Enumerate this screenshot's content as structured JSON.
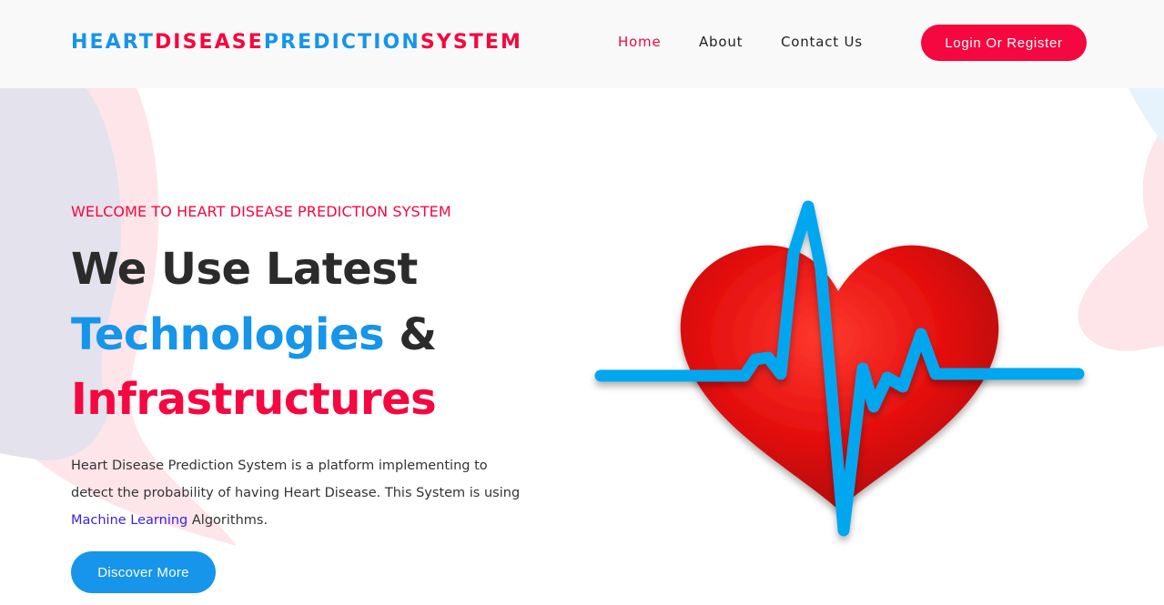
{
  "header": {
    "logo_parts": [
      "HEART",
      "DISEASE",
      "PREDICTION",
      "SYSTEM"
    ],
    "nav": [
      {
        "label": "Home",
        "active": true
      },
      {
        "label": "About",
        "active": false
      },
      {
        "label": "Contact Us",
        "active": false
      }
    ],
    "login_label": "Login Or Register"
  },
  "hero": {
    "welcome": "WELCOME TO HEART DISEASE PREDICTION SYSTEM",
    "line1": "We Use Latest",
    "line2_highlight": "Technologies",
    "line2_rest": "&",
    "line3": "Infrastructures",
    "description_before": "Heart Disease Prediction System is a platform implementing to detect the probability of having Heart Disease. This System is using",
    "description_link": "Machine Learning",
    "description_after": "Algorithms.",
    "discover_label": "Discover More"
  },
  "illustration": {
    "name": "heart-pulse-icon"
  },
  "colors": {
    "brand_blue": "#1695ea",
    "brand_red": "#f5073f",
    "heading_dark": "#2b2b2b",
    "link_purple": "#3c23d9",
    "header_bg": "#f9f9f9"
  }
}
